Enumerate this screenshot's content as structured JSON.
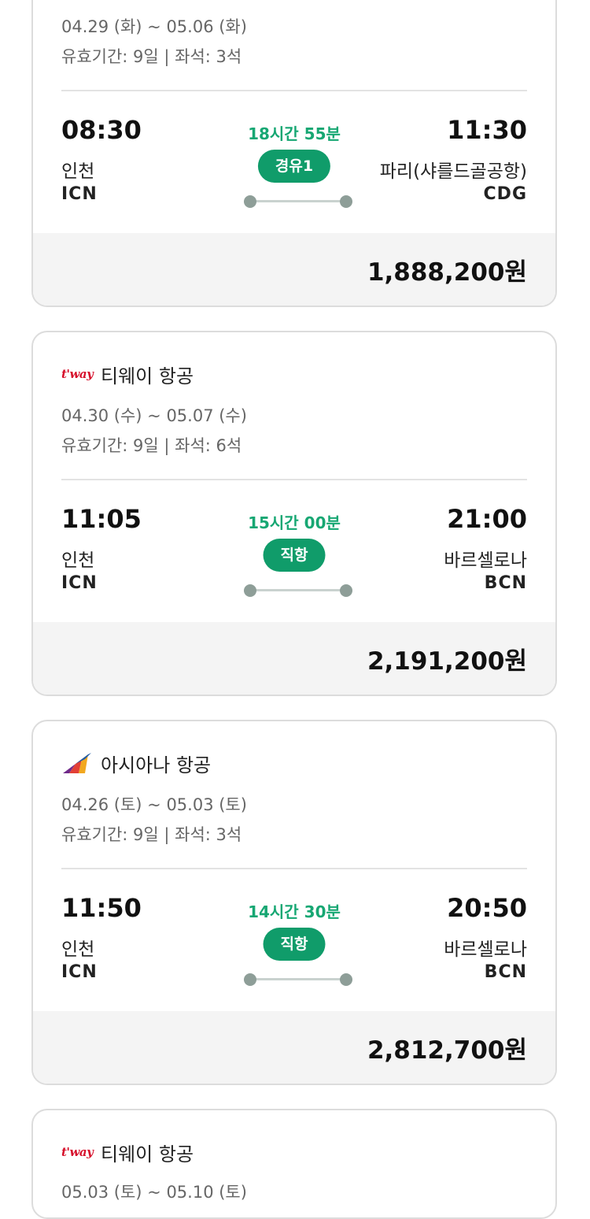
{
  "cards": [
    {
      "dates": "04.29 (화) ~ 05.06 (화)",
      "meta": "유효기간: 9일 | 좌석: 3석",
      "depart_time": "08:30",
      "depart_city": "인천",
      "depart_code": "ICN",
      "duration": "18시간 55분",
      "stops": "경유1",
      "arrive_time": "11:30",
      "arrive_city": "파리(샤를드골공항)",
      "arrive_code": "CDG",
      "price": "1,888,200원"
    },
    {
      "airline_logo": "t'way",
      "airline": "티웨이 항공",
      "dates": "04.30 (수) ~ 05.07 (수)",
      "meta": "유효기간: 9일 | 좌석: 6석",
      "depart_time": "11:05",
      "depart_city": "인천",
      "depart_code": "ICN",
      "duration": "15시간 00분",
      "stops": "직항",
      "arrive_time": "21:00",
      "arrive_city": "바르셀로나",
      "arrive_code": "BCN",
      "price": "2,191,200원"
    },
    {
      "airline_logo": "asiana-logo-icon",
      "airline": "아시아나 항공",
      "dates": "04.26 (토) ~ 05.03 (토)",
      "meta": "유효기간: 9일 | 좌석: 3석",
      "depart_time": "11:50",
      "depart_city": "인천",
      "depart_code": "ICN",
      "duration": "14시간 30분",
      "stops": "직항",
      "arrive_time": "20:50",
      "arrive_city": "바르셀로나",
      "arrive_code": "BCN",
      "price": "2,812,700원"
    },
    {
      "airline_logo": "t'way",
      "airline": "티웨이 항공",
      "dates": "05.03 (토) ~ 05.10 (토)"
    }
  ],
  "colors": {
    "accent_green": "#17a773",
    "badge_green": "#109c6a",
    "tway_red": "#d6102b"
  }
}
